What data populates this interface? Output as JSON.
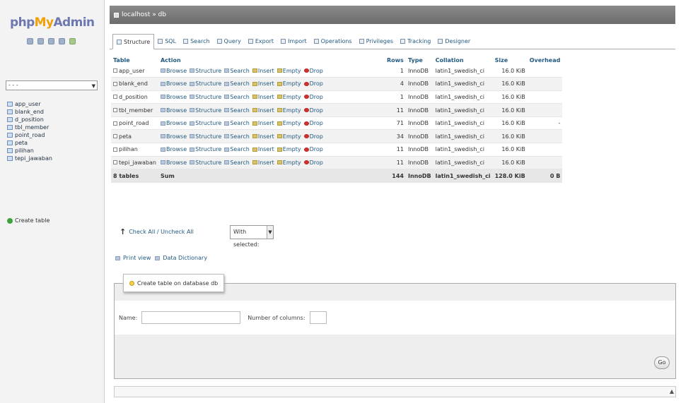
{
  "app": {
    "logo_php": "php",
    "logo_my": "My",
    "logo_admin": "Admin"
  },
  "sidebar": {
    "db_select_value": "- - -",
    "tables": [
      "app_user",
      "blank_end",
      "d_position",
      "tbl_member",
      "point_road",
      "peta",
      "pilihan",
      "tepi_jawaban"
    ],
    "create_table_label": "Create table"
  },
  "topbar": {
    "breadcrumb": "localhost » db"
  },
  "tabs": [
    {
      "label": "Structure",
      "active": true
    },
    {
      "label": "SQL",
      "active": false
    },
    {
      "label": "Search",
      "active": false
    },
    {
      "label": "Query",
      "active": false
    },
    {
      "label": "Export",
      "active": false
    },
    {
      "label": "Import",
      "active": false
    },
    {
      "label": "Operations",
      "active": false
    },
    {
      "label": "Privileges",
      "active": false
    },
    {
      "label": "Tracking",
      "active": false
    },
    {
      "label": "Designer",
      "active": false
    }
  ],
  "table": {
    "headers": [
      "Table",
      "Action",
      "Rows",
      "Type",
      "Collation",
      "Size",
      "Overhead"
    ],
    "actions": [
      "Browse",
      "Structure",
      "Search",
      "Insert",
      "Empty",
      "Drop"
    ],
    "rows": [
      {
        "name": "app_user",
        "rows": "1",
        "type": "InnoDB",
        "collation": "latin1_swedish_ci",
        "size": "16.0 KiB",
        "overhead": ""
      },
      {
        "name": "blank_end",
        "rows": "4",
        "type": "InnoDB",
        "collation": "latin1_swedish_ci",
        "size": "16.0 KiB",
        "overhead": ""
      },
      {
        "name": "d_position",
        "rows": "1",
        "type": "InnoDB",
        "collation": "latin1_swedish_ci",
        "size": "16.0 KiB",
        "overhead": ""
      },
      {
        "name": "tbl_member",
        "rows": "11",
        "type": "InnoDB",
        "collation": "latin1_swedish_ci",
        "size": "16.0 KiB",
        "overhead": ""
      },
      {
        "name": "point_road",
        "rows": "71",
        "type": "InnoDB",
        "collation": "latin1_swedish_ci",
        "size": "16.0 KiB",
        "overhead": "-"
      },
      {
        "name": "peta",
        "rows": "34",
        "type": "InnoDB",
        "collation": "latin1_swedish_ci",
        "size": "16.0 KiB",
        "overhead": ""
      },
      {
        "name": "pilihan",
        "rows": "11",
        "type": "InnoDB",
        "collation": "latin1_swedish_ci",
        "size": "16.0 KiB",
        "overhead": ""
      },
      {
        "name": "tepi_jawaban",
        "rows": "11",
        "type": "InnoDB",
        "collation": "latin1_swedish_ci",
        "size": "16.0 KiB",
        "overhead": ""
      }
    ],
    "summary": {
      "name": "8 tables",
      "action": "Sum",
      "rows": "144",
      "type": "InnoDB",
      "collation": "latin1_swedish_ci",
      "size": "128.0 KiB",
      "overhead": "0 B"
    }
  },
  "bulk": {
    "check_all_label": "Check All / Uncheck All",
    "with_selected": "With selected:"
  },
  "links": {
    "print_view": "Print view",
    "data_dictionary": "Data Dictionary"
  },
  "create_form": {
    "legend": "Create table on database db",
    "name_label": "Name:",
    "columns_label": "Number of columns:",
    "go_label": "Go"
  }
}
